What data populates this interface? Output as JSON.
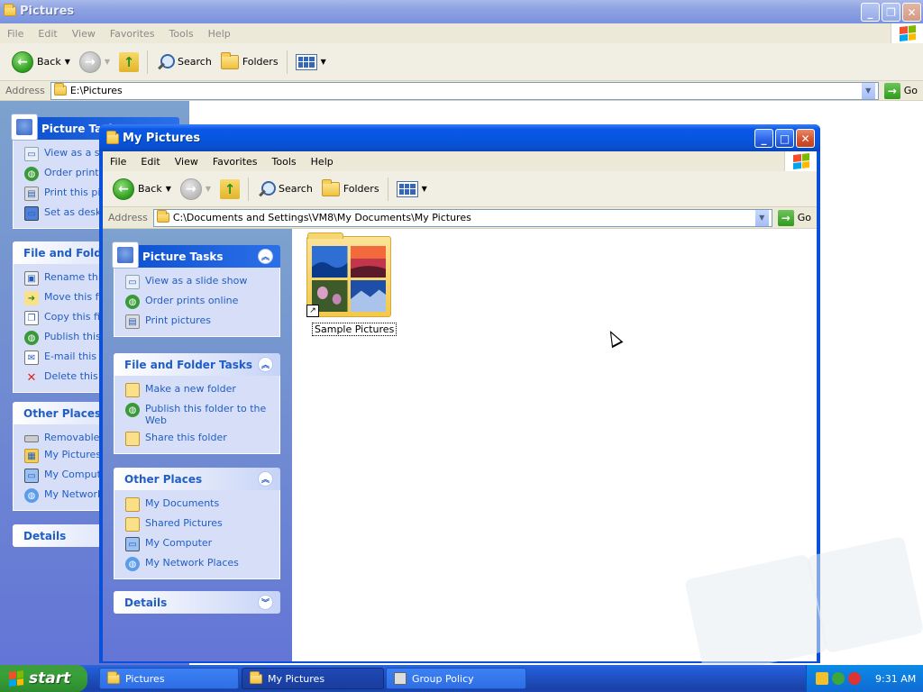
{
  "back_window": {
    "title": "Pictures",
    "menu": [
      "File",
      "Edit",
      "View",
      "Favorites",
      "Tools",
      "Help"
    ],
    "toolbar": {
      "back": "Back",
      "search": "Search",
      "folders": "Folders"
    },
    "address_label": "Address",
    "address_value": "E:\\Pictures",
    "go": "Go",
    "taskpane": {
      "picture_tasks": {
        "title": "Picture Tasks",
        "items": [
          "View as a slid",
          "Order prints",
          "Print this pict",
          "Set as deskto"
        ]
      },
      "file_folder_tasks": {
        "title": "File and Folder",
        "items": [
          "Rename this",
          "Move this file",
          "Copy this file",
          "Publish this f",
          "E-mail this fil",
          "Delete this fil"
        ]
      },
      "other_places": {
        "title": "Other Places",
        "items": [
          "Removable D",
          "My Pictures",
          "My Compute",
          "My Network"
        ]
      },
      "details": {
        "title": "Details"
      }
    }
  },
  "front_window": {
    "title": "My Pictures",
    "menu": [
      "File",
      "Edit",
      "View",
      "Favorites",
      "Tools",
      "Help"
    ],
    "toolbar": {
      "back": "Back",
      "search": "Search",
      "folders": "Folders"
    },
    "address_label": "Address",
    "address_value": "C:\\Documents and Settings\\VM8\\My Documents\\My Pictures",
    "go": "Go",
    "taskpane": {
      "picture_tasks": {
        "title": "Picture Tasks",
        "items": [
          "View as a slide show",
          "Order prints online",
          "Print pictures"
        ]
      },
      "file_folder_tasks": {
        "title": "File and Folder Tasks",
        "items": [
          "Make a new folder",
          "Publish this folder to the Web",
          "Share this folder"
        ]
      },
      "other_places": {
        "title": "Other Places",
        "items": [
          "My Documents",
          "Shared Pictures",
          "My Computer",
          "My Network Places"
        ]
      },
      "details": {
        "title": "Details"
      }
    },
    "items": [
      {
        "label": "Sample Pictures"
      }
    ]
  },
  "taskbar": {
    "start": "start",
    "tasks": [
      {
        "label": "Pictures"
      },
      {
        "label": "My Pictures"
      },
      {
        "label": "Group Policy"
      }
    ],
    "clock": "9:31 AM"
  }
}
